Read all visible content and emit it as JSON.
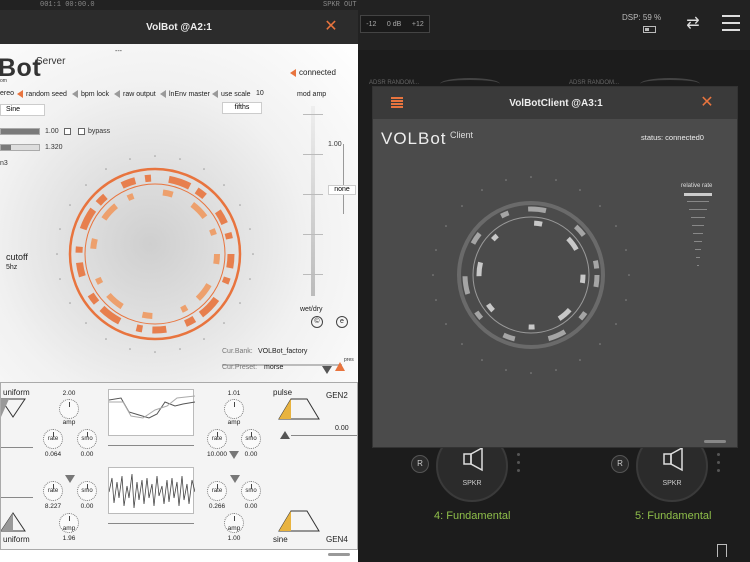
{
  "host": {
    "top_counter": "001:1   00:00.0",
    "spkr_out": "SPKR OUT",
    "meter_labels": [
      "-12",
      "0 dB",
      "+12"
    ],
    "dsp": "DSP: 59 %",
    "adsr_left": "ADSR RANDOM...",
    "adsr_right": "ADSR RANDOM...",
    "node_left": {
      "r": "R",
      "spkr": "SPKR",
      "label": "4: Fundamental"
    },
    "node_right": {
      "r": "R",
      "spkr": "SPKR",
      "label": "5: Fundamental"
    }
  },
  "server": {
    "title": "VolBot @A2:1",
    "brand": "Bot",
    "brand_sub": "Server",
    "brand_small": "om",
    "dashes": "---",
    "connected": "connected",
    "options": [
      "ereo",
      "random seed",
      "bpm lock",
      "raw output",
      "lnEnv master",
      "use scale"
    ],
    "scale_count": "10",
    "wave": "Sine",
    "scale": "fifths",
    "mod_amp": "mod amp",
    "mod_amp_value": "1.00",
    "none": "none",
    "slider1_value": "1.00",
    "bypass": "bypass",
    "slider2_value": "1.320",
    "n3": "n3",
    "cutoff": "cutoff",
    "cutoff_value": "5hz",
    "wet_dry": "wet/dry",
    "copyright": "©",
    "e_icon": "e",
    "cur_bank_label": "Cur.Bank:",
    "cur_bank": "VOLBot_factory",
    "cur_preset_label": "Cur.Preset:",
    "cur_preset": "morse",
    "pres": "pres",
    "gen": {
      "uniform_top": "uniform",
      "uniform_bottom": "uniform",
      "gen2": "GEN2",
      "gen4": "GEN4",
      "pulse": "pulse",
      "sine": "sine",
      "amp_top_left": "2.00",
      "amp_top_right": "1.01",
      "amp_label": "amp",
      "rate_label": "rate",
      "smo_label": "smo",
      "rate1": "0.064",
      "smo1": "0.00",
      "rate2": "10.000",
      "smo2": "0.00",
      "right_value": "0.00",
      "rate3": "8.227",
      "smo3": "0.00",
      "rate4": "0.266",
      "smo4": "0.00",
      "amp_bottom_left": "1.96",
      "amp_bottom_right": "1.00"
    }
  },
  "client": {
    "title": "VolBotClient @A3:1",
    "brand": "VOLBot",
    "brand_sub": "Client",
    "status": "status: connected0",
    "relative_rate": "relative rate"
  },
  "colors": {
    "accent": "#e8743e",
    "accent_light": "#eda06d",
    "host_green": "#8fbf4a",
    "client_bg": "#4b4b4b"
  }
}
